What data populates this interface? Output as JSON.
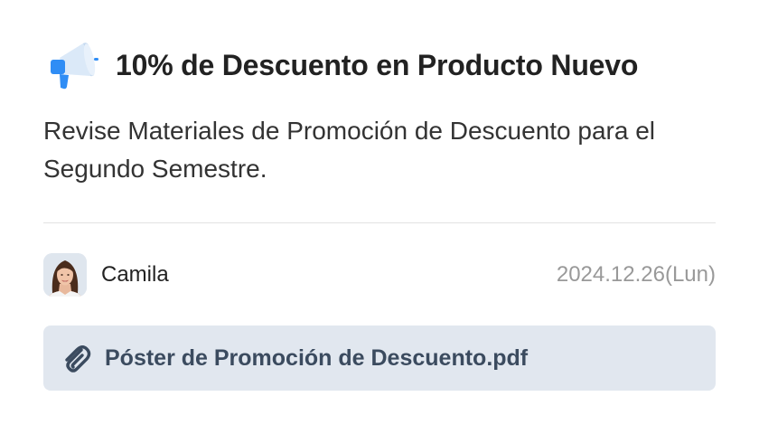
{
  "announcement": {
    "icon": "megaphone-icon",
    "title": "10% de Descuento en Producto Nuevo",
    "description": "Revise Materiales de Promoción de Descuento para el Segundo Semestre."
  },
  "author": {
    "name": "Camila",
    "avatar": "avatar-photo"
  },
  "date": "2024.12.26(Lun)",
  "attachment": {
    "icon": "paperclip-icon",
    "filename": "Póster de Promoción de Descuento.pdf"
  },
  "colors": {
    "accent_blue": "#2f8df5",
    "attachment_bg": "#e1e7ef",
    "attachment_text": "#3b4b5f",
    "date_text": "#999999"
  }
}
